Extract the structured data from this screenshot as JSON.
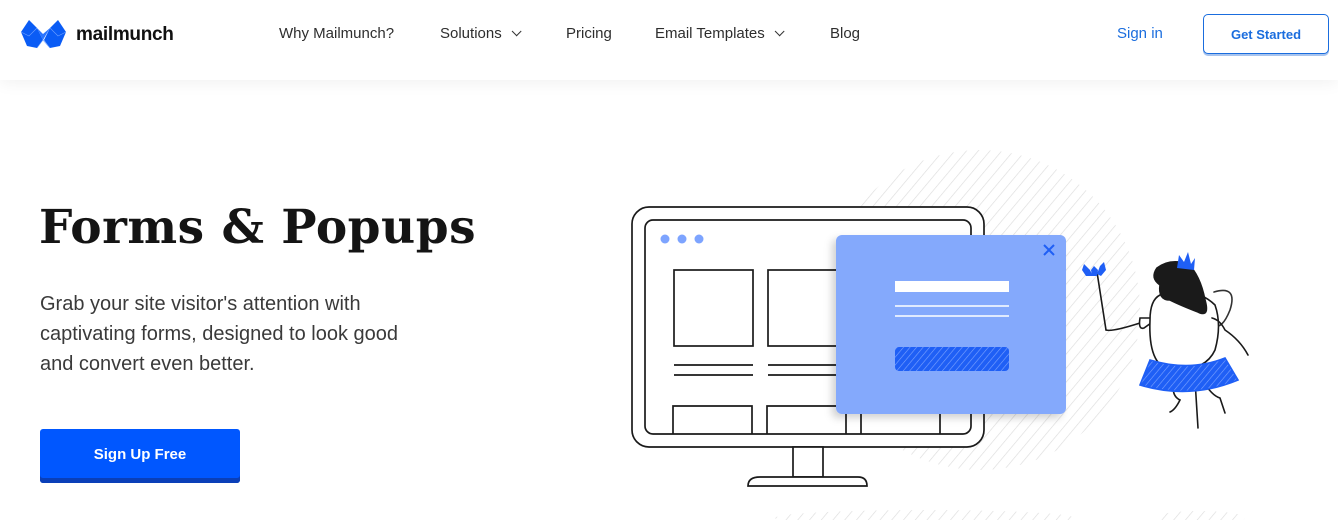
{
  "header": {
    "logo_text": "mailmunch",
    "nav": [
      {
        "label": "Why Mailmunch?",
        "dropdown": false
      },
      {
        "label": "Solutions",
        "dropdown": true
      },
      {
        "label": "Pricing",
        "dropdown": false
      },
      {
        "label": "Email Templates",
        "dropdown": true
      },
      {
        "label": "Blog",
        "dropdown": false
      }
    ],
    "sign_in": "Sign in",
    "get_started": "Get Started"
  },
  "hero": {
    "title": "Forms & Popups",
    "description": "Grab your site visitor's attention with captivating forms, designed to look good and convert even better.",
    "cta": "Sign Up Free"
  },
  "illustration": {
    "popup_close_icon": "close-icon",
    "subject": "monitor-with-popup-and-fairy-character"
  },
  "colors": {
    "brand_blue": "#0057ff",
    "link_blue": "#1a6dde",
    "popup_blue": "#84a9fc",
    "text_dark": "#141414"
  }
}
